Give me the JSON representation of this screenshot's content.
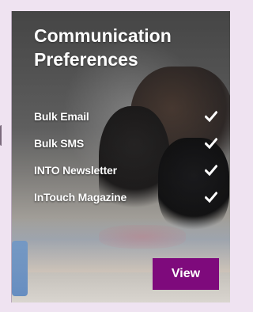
{
  "card": {
    "title": "Communication Preferences",
    "preferences": [
      {
        "label": "Bulk Email",
        "checked": true,
        "icon": "checkmark-icon"
      },
      {
        "label": "Bulk SMS",
        "checked": true,
        "icon": "checkmark-icon"
      },
      {
        "label": "INTO Newsletter",
        "checked": true,
        "icon": "checkmark-icon"
      },
      {
        "label": "InTouch Magazine",
        "checked": true,
        "icon": "checkmark-icon"
      }
    ],
    "view_label": "View"
  },
  "colors": {
    "page_background": "#efe3f1",
    "button": "#7e0a7c",
    "text": "#ffffff"
  }
}
